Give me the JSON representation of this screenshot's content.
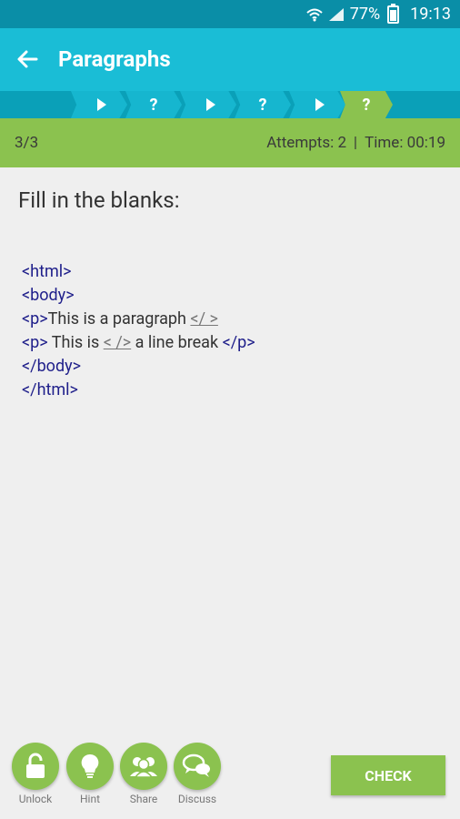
{
  "status_bar": {
    "battery": "77%",
    "time": "19:13",
    "icons": [
      "wifi-icon",
      "signal-icon",
      "battery-icon"
    ]
  },
  "app_bar": {
    "title": "Paragraphs",
    "back_icon": "back-arrow-icon"
  },
  "progress": {
    "steps": [
      {
        "type": "play",
        "label": ""
      },
      {
        "type": "question",
        "label": "?"
      },
      {
        "type": "play",
        "label": ""
      },
      {
        "type": "question",
        "label": "?"
      },
      {
        "type": "play",
        "label": ""
      },
      {
        "type": "question",
        "label": "?"
      }
    ],
    "active_index": 5
  },
  "info_bar": {
    "step": "3/3",
    "attempts": "Attempts: 2",
    "separator": "|",
    "time": "Time: 00:19"
  },
  "content": {
    "prompt": "Fill in the blanks:",
    "code": {
      "line1": "<html>",
      "line2": "<body>",
      "line3_open": "<p>",
      "line3_text": "This is a paragraph ",
      "line3_blank": "</  >",
      "line4_open": "<p>",
      "line4_text1": " This is ",
      "line4_blank": "<   />",
      "line4_text2": " a line break ",
      "line4_close": "</p>",
      "line5": "</body>",
      "line6": "</html>"
    }
  },
  "bottom_bar": {
    "tools": [
      {
        "label": "Unlock",
        "icon": "lock-icon"
      },
      {
        "label": "Hint",
        "icon": "lightbulb-icon"
      },
      {
        "label": "Share",
        "icon": "people-icon"
      },
      {
        "label": "Discuss",
        "icon": "chat-bubbles-icon"
      }
    ],
    "check_label": "CHECK"
  },
  "colors": {
    "status_bar": "#0a8ea7",
    "app_bar": "#1abdd6",
    "accent_green": "#8bc24f",
    "code_tag": "#1e1e8a"
  }
}
